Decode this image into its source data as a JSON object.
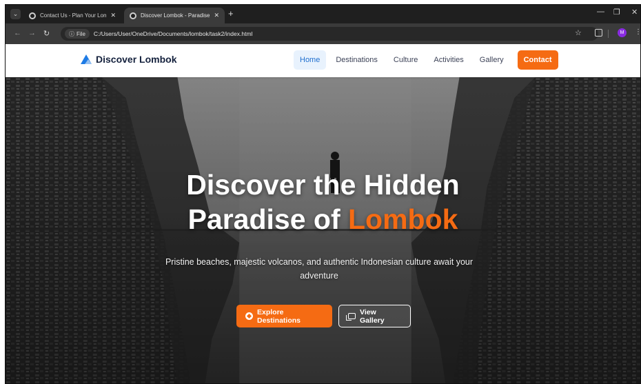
{
  "browser": {
    "tabs": [
      {
        "title": "Contact Us - Plan Your Lombok",
        "active": false
      },
      {
        "title": "Discover Lombok - Paradise Isl",
        "active": true
      }
    ],
    "new_tab": "+",
    "tab_close": "✕",
    "address": {
      "scheme_chip": "File",
      "url": "C:/Users/User/OneDrive/Documents/lombok/task2/index.html"
    },
    "profile_initial": "M",
    "window_controls": {
      "minimize": "—",
      "maximize": "❐",
      "close": "✕"
    }
  },
  "site": {
    "brand": "Discover Lombok",
    "nav": [
      {
        "label": "Home",
        "state": "active"
      },
      {
        "label": "Destinations",
        "state": "normal"
      },
      {
        "label": "Culture",
        "state": "normal"
      },
      {
        "label": "Activities",
        "state": "normal"
      },
      {
        "label": "Gallery",
        "state": "normal"
      },
      {
        "label": "Contact",
        "state": "cta"
      }
    ]
  },
  "hero": {
    "title_line1": "Discover the Hidden",
    "title_line2_prefix": "Paradise of ",
    "title_line2_accent": "Lombok",
    "subtitle": "Pristine beaches, majestic volcanos, and authentic Indonesian culture await your adventure",
    "primary_button": "Explore Destinations",
    "secondary_button": "View Gallery"
  },
  "colors": {
    "accent": "#f56b13",
    "brand_blue": "#1e7be5",
    "nav_active_bg": "#e8f2fd"
  },
  "icons": {
    "brand": "mountain-icon",
    "primary_button": "compass-icon",
    "secondary_button": "images-icon"
  }
}
